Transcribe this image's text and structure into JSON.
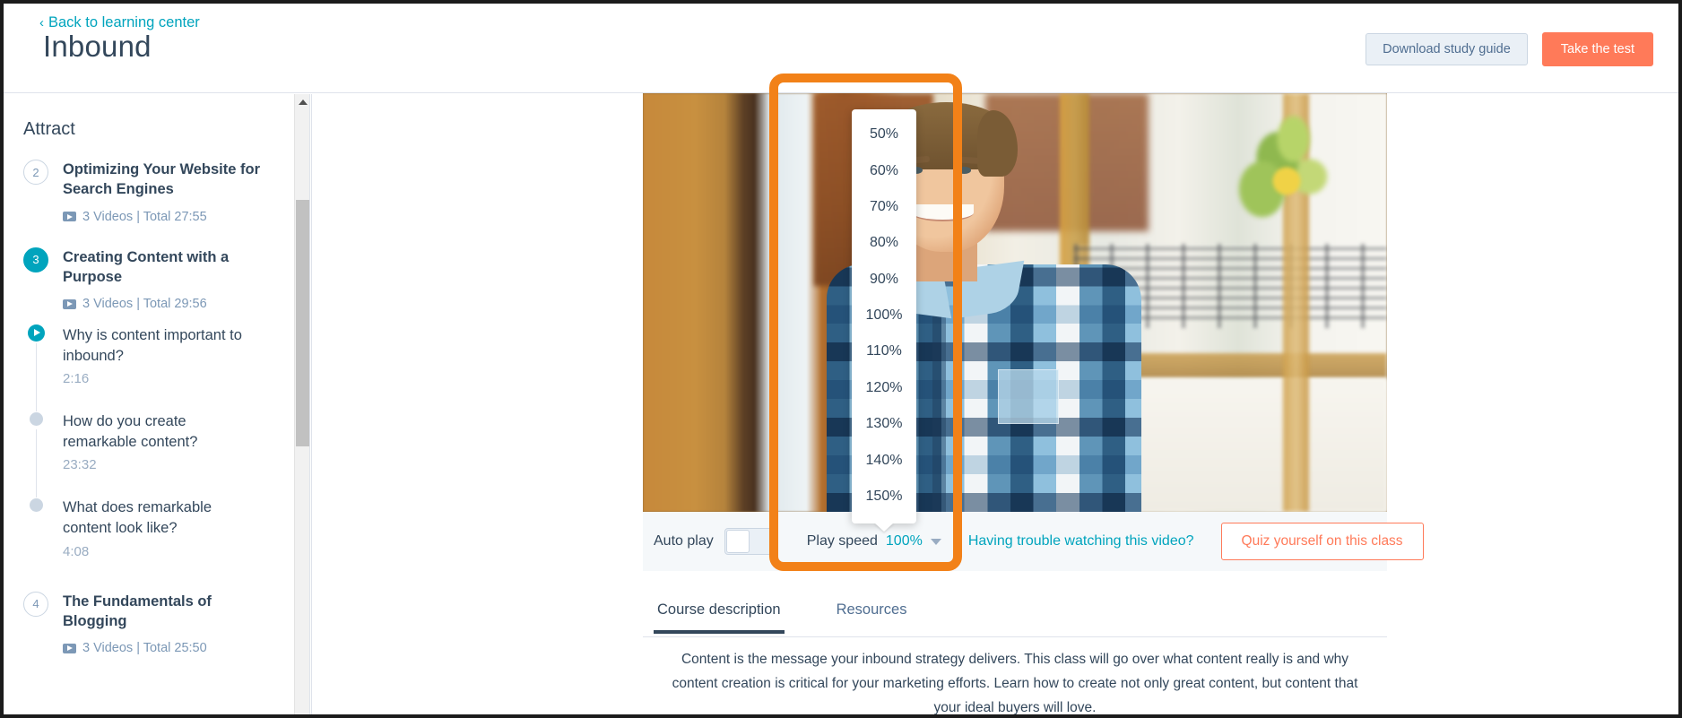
{
  "header": {
    "back_link": "Back to learning center",
    "back_chevron": "‹",
    "title": "Inbound",
    "download_button": "Download study guide",
    "test_button": "Take the test"
  },
  "sidebar": {
    "section_title": "Attract",
    "courses": [
      {
        "number": "2",
        "title": "Optimizing Your Website for Search Engines",
        "meta": "3 Videos | Total 27:55",
        "state": "inactive",
        "lessons": []
      },
      {
        "number": "3",
        "title": "Creating Content with a Purpose",
        "meta": "3 Videos | Total 29:56",
        "state": "active",
        "lessons": [
          {
            "title": "Why is content important to inbound?",
            "time": "2:16",
            "state": "playing"
          },
          {
            "title": "How do you create remarkable content?",
            "time": "23:32",
            "state": "pending"
          },
          {
            "title": "What does remarkable content look like?",
            "time": "4:08",
            "state": "pending"
          }
        ]
      },
      {
        "number": "4",
        "title": "The Fundamentals of Blogging",
        "meta": "3 Videos | Total 25:50",
        "state": "inactive",
        "lessons": []
      }
    ]
  },
  "player": {
    "auto_play_label": "Auto play",
    "auto_play_state": "off",
    "play_speed_label": "Play speed",
    "play_speed_value": "100%",
    "trouble_link": "Having trouble watching this video?",
    "quiz_button": "Quiz yourself on this class",
    "speed_options": [
      "50%",
      "60%",
      "70%",
      "80%",
      "90%",
      "100%",
      "110%",
      "120%",
      "130%",
      "140%",
      "150%"
    ]
  },
  "tabs": [
    {
      "label": "Course description",
      "active": true
    },
    {
      "label": "Resources",
      "active": false
    }
  ],
  "description": "Content is the message your inbound strategy delivers. This class will go over what content really is and why content creation is critical for your marketing efforts. Learn how to create not only great content, but content that your ideal buyers will love.",
  "colors": {
    "accent_teal": "#00a4bd",
    "accent_orange": "#ff7a59",
    "highlight_box": "#F28118",
    "text_dark": "#33475b",
    "text_muted": "#7c98b6"
  }
}
